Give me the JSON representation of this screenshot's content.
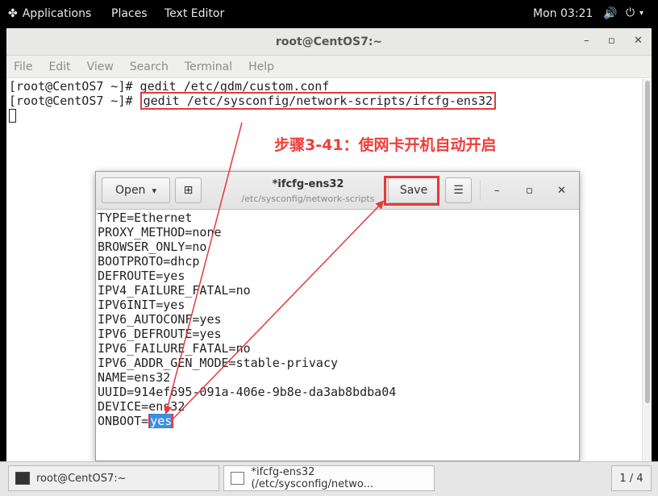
{
  "topbar": {
    "applications": "Applications",
    "places": "Places",
    "text_editor": "Text Editor",
    "clock": "Mon 03:21",
    "volume_icon": "🔊",
    "power_icon": "⏻",
    "menu_caret": "▾",
    "apps_icon": "✤"
  },
  "terminal": {
    "title": "root@CentOS7:~",
    "minimize": "–",
    "maximize": "▫",
    "close": "✕",
    "menu": [
      "File",
      "Edit",
      "View",
      "Search",
      "Terminal",
      "Help"
    ],
    "line1": "[root@CentOS7 ~]# gedit /etc/gdm/custom.conf",
    "line2_prompt": "[root@CentOS7 ~]# ",
    "line2_cmd": "gedit /etc/sysconfig/network-scripts/ifcfg-ens32"
  },
  "annotation": "步骤3-41：使网卡开机自动开启",
  "gedit": {
    "open_label": "Open",
    "open_caret": "▾",
    "new_tab_icon": "⊞",
    "title": "*ifcfg-ens32",
    "subtitle": "/etc/sysconfig/network-scripts",
    "save_label": "Save",
    "menu_icon": "☰",
    "minimize": "–",
    "maximize": "▫",
    "close": "✕",
    "lines": [
      "TYPE=Ethernet",
      "PROXY_METHOD=none",
      "BROWSER_ONLY=no",
      "BOOTPROTO=dhcp",
      "DEFROUTE=yes",
      "IPV4_FAILURE_FATAL=no",
      "IPV6INIT=yes",
      "IPV6_AUTOCONF=yes",
      "IPV6_DEFROUTE=yes",
      "IPV6_FAILURE_FATAL=no",
      "IPV6_ADDR_GEN_MODE=stable-privacy",
      "NAME=ens32",
      "UUID=914ef695-091a-406e-9b8e-da3ab8bdba04",
      "DEVICE=ens32"
    ],
    "last_key": "ONBOOT=",
    "last_value": "yes"
  },
  "taskbar": {
    "task1": "root@CentOS7:~",
    "task2": "*ifcfg-ens32 (/etc/sysconfig/netwo...",
    "pager": "1 / 4"
  },
  "colors": {
    "annotation": "#ef3e3a",
    "selection": "#3e8ede"
  }
}
